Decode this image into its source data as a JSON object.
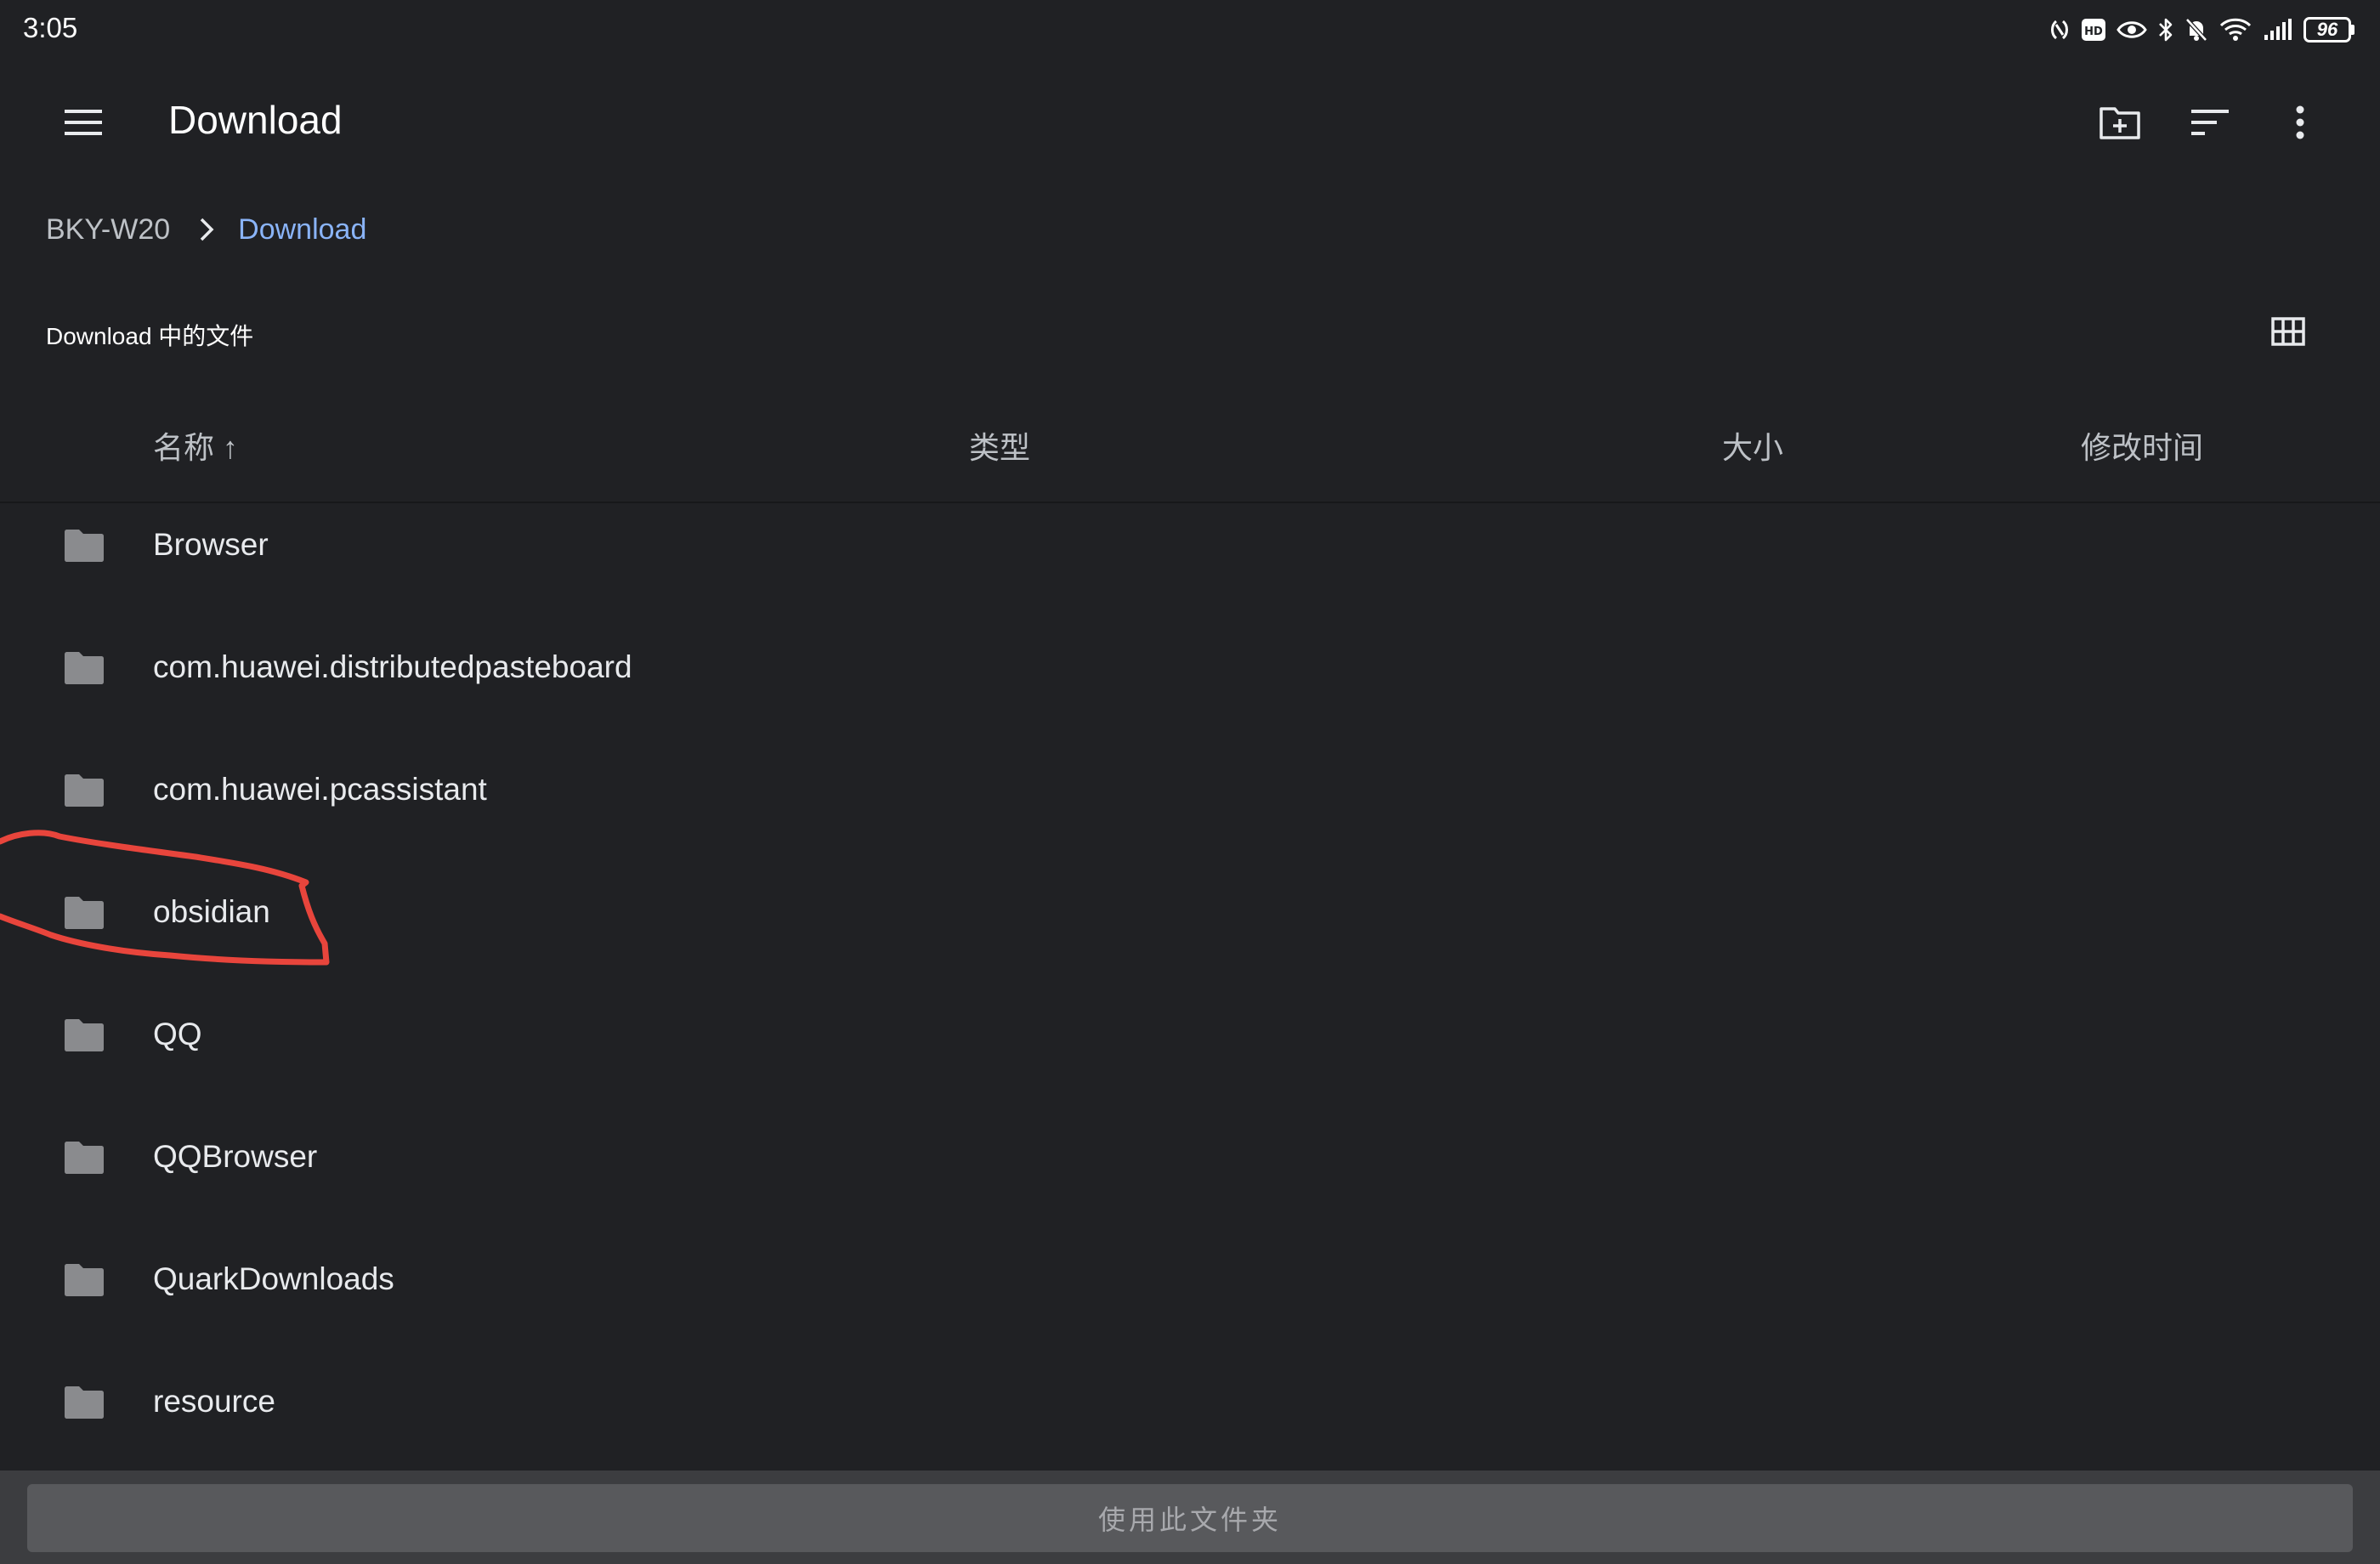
{
  "status_bar": {
    "time": "3:05",
    "battery": "96",
    "icons": [
      "nfc-icon",
      "hd-icon",
      "eye-comfort-icon",
      "bluetooth-icon",
      "mute-icon",
      "wifi-icon",
      "signal-icon",
      "battery-icon"
    ]
  },
  "app_bar": {
    "menu_icon": "hamburger-menu-icon",
    "title": "Download",
    "actions": [
      "new-folder-icon",
      "sort-icon",
      "more-options-icon"
    ]
  },
  "breadcrumb": {
    "root": "BKY-W20",
    "separator_icon": "chevron-right-icon",
    "current": "Download"
  },
  "section": {
    "title": "Download 中的文件",
    "view_toggle_icon": "grid-view-icon"
  },
  "columns": {
    "name": "名称 ↑",
    "type": "类型",
    "size": "大小",
    "modified": "修改时间"
  },
  "files": [
    {
      "name": "Browser",
      "icon": "folder-icon"
    },
    {
      "name": "com.huawei.distributedpasteboard",
      "icon": "folder-icon"
    },
    {
      "name": "com.huawei.pcassistant",
      "icon": "folder-icon"
    },
    {
      "name": "obsidian",
      "icon": "folder-icon",
      "annotated": true
    },
    {
      "name": "QQ",
      "icon": "folder-icon"
    },
    {
      "name": "QQBrowser",
      "icon": "folder-icon"
    },
    {
      "name": "QuarkDownloads",
      "icon": "folder-icon"
    },
    {
      "name": "resource",
      "icon": "folder-icon"
    }
  ],
  "bottom_bar": {
    "use_folder_label": "使用此文件夹"
  },
  "colors": {
    "background": "#202124",
    "accent_link": "#8ab4f8",
    "annotation": "#e8453c",
    "folder_icon": "#8a8b8e"
  }
}
